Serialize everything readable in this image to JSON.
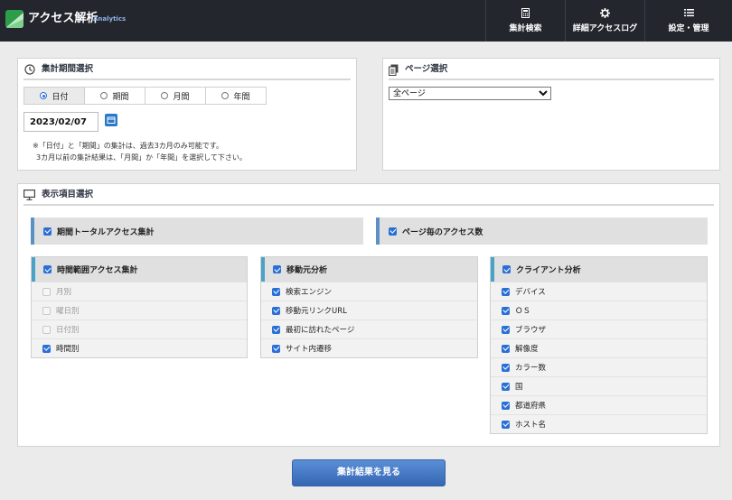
{
  "header": {
    "app_title": "アクセス解析",
    "app_subtitle": "Analytics",
    "nav": [
      {
        "label": "集計検索",
        "icon": "calculator-icon"
      },
      {
        "label": "詳細アクセスログ",
        "icon": "gear-icon"
      },
      {
        "label": "設定・管理",
        "icon": "list-icon"
      }
    ]
  },
  "period": {
    "title": "集計期間選択",
    "icon": "clock-icon",
    "tabs": [
      {
        "label": "日付",
        "selected": true
      },
      {
        "label": "期間",
        "selected": false
      },
      {
        "label": "月間",
        "selected": false
      },
      {
        "label": "年間",
        "selected": false
      }
    ],
    "date_value": "2023/02/07",
    "note_line1": "※「日付」と「期間」の集計は、過去3カ月のみ可能です。",
    "note_line2": "3カ月以前の集計結果は、「月間」か「年間」を選択して下さい。"
  },
  "page_select": {
    "title": "ページ選択",
    "icon": "document-icon",
    "selected": "全ページ"
  },
  "display": {
    "title": "表示項目選択",
    "icon": "monitor-icon",
    "period_total": {
      "label": "期間トータルアクセス集計",
      "checked": true
    },
    "per_page": {
      "label": "ページ毎のアクセス数",
      "checked": true
    },
    "time_range": {
      "label": "時間範囲アクセス集計",
      "checked": true,
      "items": [
        {
          "label": "月別",
          "checked": false,
          "disabled": true
        },
        {
          "label": "曜日別",
          "checked": false,
          "disabled": true
        },
        {
          "label": "日付別",
          "checked": false,
          "disabled": true
        },
        {
          "label": "時間別",
          "checked": true,
          "disabled": false
        }
      ]
    },
    "referrer": {
      "label": "移動元分析",
      "checked": true,
      "items": [
        {
          "label": "検索エンジン",
          "checked": true
        },
        {
          "label": "移動元リンクURL",
          "checked": true
        },
        {
          "label": "最初に訪れたページ",
          "checked": true
        },
        {
          "label": "サイト内遷移",
          "checked": true
        }
      ]
    },
    "client": {
      "label": "クライアント分析",
      "checked": true,
      "items": [
        {
          "label": "デバイス",
          "checked": true
        },
        {
          "label": "ＯＳ",
          "checked": true
        },
        {
          "label": "ブラウザ",
          "checked": true
        },
        {
          "label": "解像度",
          "checked": true
        },
        {
          "label": "カラー数",
          "checked": true
        },
        {
          "label": "国",
          "checked": true
        },
        {
          "label": "都道府県",
          "checked": true
        },
        {
          "label": "ホスト名",
          "checked": true
        }
      ]
    }
  },
  "submit_label": "集計結果を見る",
  "colors": {
    "header_bg": "#23262d",
    "accent_blue": "#2a6fd6",
    "logo_green": "#2e9d4a"
  }
}
